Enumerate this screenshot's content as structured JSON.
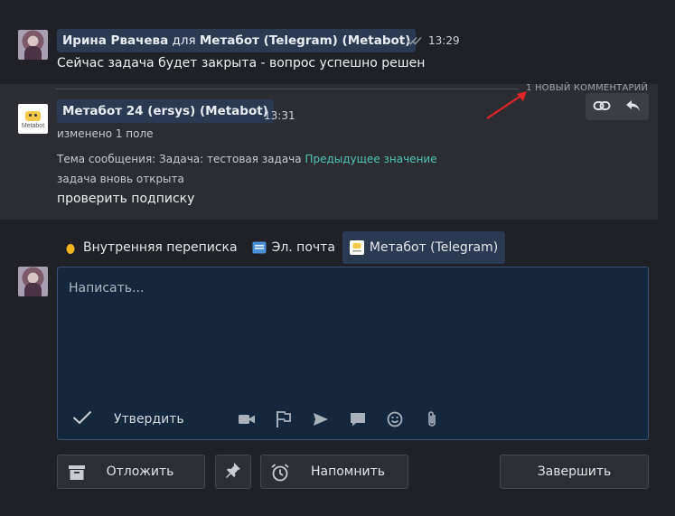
{
  "message1": {
    "sender": "Ирина Рвачева",
    "for_word": "для",
    "recipient": "Метабот (Telegram) (Metabot)",
    "time": "13:29",
    "text": "Сейчас задача будет закрыта - вопрос успешно решен"
  },
  "new_comment_label": "1 НОВЫЙ КОММЕНТАРИЙ",
  "message2": {
    "sender": "Метабот 24 (ersys) (Metabot)",
    "time": "13:31",
    "logo_text": "Metabot",
    "changed": "изменено 1 поле",
    "subject_change": "Тема сообщения: Задача: тестовая задача",
    "prev_value_link": "Предыдущее значение",
    "reopened": "задача вновь открыта",
    "text": "проверить подписку"
  },
  "tabs": [
    {
      "label": "Внутренняя переписка",
      "icon": "lemon-icon",
      "active": false
    },
    {
      "label": "Эл. почта",
      "icon": "email-icon",
      "active": false
    },
    {
      "label": "Метабот (Telegram)",
      "icon": "metabot-icon",
      "active": true
    }
  ],
  "composer": {
    "placeholder": "Написать...",
    "confirm_label": "Утвердить",
    "tools": [
      "video-icon",
      "flag-icon",
      "send-icon",
      "chat-icon",
      "emoji-icon",
      "attach-icon"
    ]
  },
  "buttons": {
    "postpone": "Отложить",
    "remind": "Напомнить",
    "finish": "Завершить"
  },
  "colors": {
    "background": "#1f2126",
    "card": "#2b2d33",
    "name_chip": "#2b3a52",
    "composer": "#14273c",
    "link": "#4fc3b0",
    "arrow": "#e0242a"
  }
}
